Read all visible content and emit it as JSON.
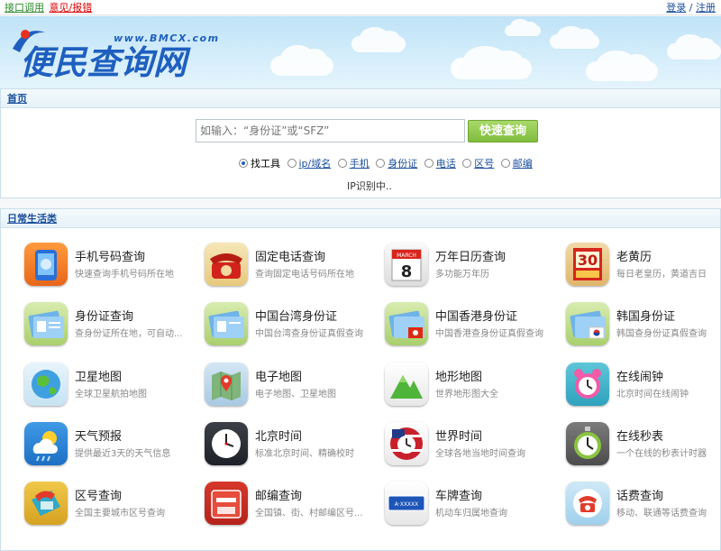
{
  "topbar": {
    "api_link": "接口调用",
    "feedback_link": "意见/报错",
    "login_link": "登录",
    "separator": "/",
    "register_link": "注册"
  },
  "logo": {
    "url_text": "www.BMCX.com",
    "main_text": "便民查询网"
  },
  "nav": {
    "home": "首页"
  },
  "search": {
    "placeholder": "如输入：“身份证”或“SFZ”",
    "button": "快速查询",
    "options": [
      "找工具",
      "ip/域名",
      "手机",
      "身份证",
      "电话",
      "区号",
      "邮编"
    ],
    "selected": "找工具",
    "ip_status": "IP识别中.."
  },
  "section": {
    "title": "日常生活类"
  },
  "tools": [
    {
      "name": "手机号码查询",
      "desc": "快速查询手机号码所在地",
      "icon": "phone-hand-icon"
    },
    {
      "name": "固定电话查询",
      "desc": "查询固定电话号码所在地",
      "icon": "rotary-phone-icon"
    },
    {
      "name": "万年日历查询",
      "desc": "多功能万年历",
      "icon": "calendar-icon"
    },
    {
      "name": "老黄历",
      "desc": "每日老皇历，黄道吉日",
      "icon": "old-almanac-icon"
    },
    {
      "name": "身份证查询",
      "desc": "查身份证所在地，可自动...",
      "icon": "id-card-icon"
    },
    {
      "name": "中国台湾身份证",
      "desc": "中国台湾查身份证真假查询",
      "icon": "id-card-taiwan-icon"
    },
    {
      "name": "中国香港身份证",
      "desc": "中国香港查身份证真假查询",
      "icon": "id-card-hongkong-icon"
    },
    {
      "name": "韩国身份证",
      "desc": "韩国查身份证真假查询",
      "icon": "id-card-korea-icon"
    },
    {
      "name": "卫星地图",
      "desc": "全球卫星航拍地图",
      "icon": "globe-icon"
    },
    {
      "name": "电子地图",
      "desc": "电子地图、卫星地图",
      "icon": "map-pin-icon"
    },
    {
      "name": "地形地图",
      "desc": "世界地形图大全",
      "icon": "mountain-icon"
    },
    {
      "name": "在线闹钟",
      "desc": "北京时间在线闹钟",
      "icon": "alarm-clock-icon"
    },
    {
      "name": "天气预报",
      "desc": "提供最近3天的天气信息",
      "icon": "weather-icon"
    },
    {
      "name": "北京时间",
      "desc": "标准北京时间、精确校时",
      "icon": "wall-clock-icon"
    },
    {
      "name": "世界时间",
      "desc": "全球各地当地时间查询",
      "icon": "world-clock-icon"
    },
    {
      "name": "在线秒表",
      "desc": "一个在线的秒表计时器",
      "icon": "stopwatch-icon"
    },
    {
      "name": "区号查询",
      "desc": "全国主要城市区号查询",
      "icon": "area-code-phone-icon"
    },
    {
      "name": "邮编查询",
      "desc": "全国镇、街、村邮编区号...",
      "icon": "mailbox-icon"
    },
    {
      "name": "车牌查询",
      "desc": "机动车归属地查询",
      "icon": "license-plate-icon"
    },
    {
      "name": "话费查询",
      "desc": "移动、联通等话费查询",
      "icon": "phone-bill-icon"
    }
  ],
  "calendar_icon_text": {
    "month": "MARCH",
    "day": "8"
  },
  "almanac_icon_text": {
    "day": "30"
  },
  "plate_icon_text": {
    "plate": "A·XXXXX"
  }
}
